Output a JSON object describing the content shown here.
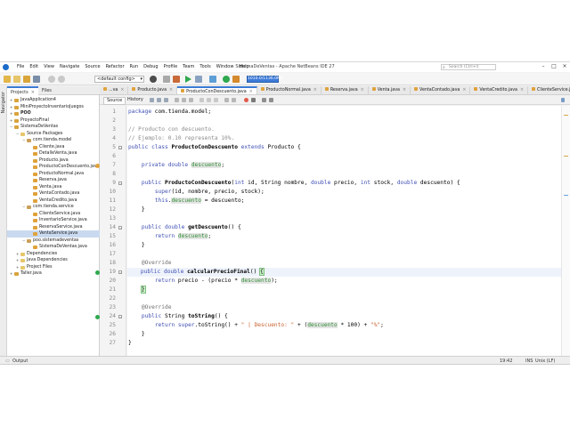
{
  "window": {
    "title": "SistemaDeVentas - Apache NetBeans IDE 27",
    "search_placeholder": "Search (Ctrl+I)"
  },
  "menu": [
    "File",
    "Edit",
    "View",
    "Navigate",
    "Source",
    "Refactor",
    "Run",
    "Debug",
    "Profile",
    "Team",
    "Tools",
    "Window",
    "Help"
  ],
  "toolbar": {
    "config": "<default config>",
    "memory": "1010.0/1136.0MB"
  },
  "left_panel": {
    "side_label": "Navigator",
    "tabs": [
      {
        "label": "Projects",
        "close": "×"
      },
      {
        "label": "Files",
        "close": ""
      }
    ],
    "tree": [
      {
        "label": "JavaApplication4",
        "depth": 0,
        "toggle": "+",
        "icon": "project",
        "bold": false
      },
      {
        "label": "MiniProyectoInventarioJuegos",
        "depth": 0,
        "toggle": "+",
        "icon": "project",
        "bold": false
      },
      {
        "label": "POO",
        "depth": 0,
        "toggle": "+",
        "icon": "project",
        "bold": true
      },
      {
        "label": "ProyectoFinal",
        "depth": 0,
        "toggle": "+",
        "icon": "project",
        "bold": false
      },
      {
        "label": "SistemaDeVentas",
        "depth": 0,
        "toggle": "−",
        "icon": "project",
        "bold": false
      },
      {
        "label": "Source Packages",
        "depth": 1,
        "toggle": "−",
        "icon": "folder",
        "bold": false
      },
      {
        "label": "com.tienda.model",
        "depth": 2,
        "toggle": "−",
        "icon": "package",
        "bold": false
      },
      {
        "label": "Cliente.java",
        "depth": 3,
        "toggle": "",
        "icon": "java",
        "bold": false
      },
      {
        "label": "DetalleVenta.java",
        "depth": 3,
        "toggle": "",
        "icon": "java",
        "bold": false
      },
      {
        "label": "Producto.java",
        "depth": 3,
        "toggle": "",
        "icon": "java",
        "bold": false
      },
      {
        "label": "ProductoConDescuento.java",
        "depth": 3,
        "toggle": "",
        "icon": "java",
        "bold": false
      },
      {
        "label": "ProductoNormal.java",
        "depth": 3,
        "toggle": "",
        "icon": "java",
        "bold": false
      },
      {
        "label": "Reserva.java",
        "depth": 3,
        "toggle": "",
        "icon": "java",
        "bold": false
      },
      {
        "label": "Venta.java",
        "depth": 3,
        "toggle": "",
        "icon": "java",
        "bold": false
      },
      {
        "label": "VentaContado.java",
        "depth": 3,
        "toggle": "",
        "icon": "java",
        "bold": false
      },
      {
        "label": "VentaCredito.java",
        "depth": 3,
        "toggle": "",
        "icon": "java",
        "bold": false
      },
      {
        "label": "com.tienda.service",
        "depth": 2,
        "toggle": "−",
        "icon": "package",
        "bold": false
      },
      {
        "label": "ClienteService.java",
        "depth": 3,
        "toggle": "",
        "icon": "java",
        "bold": false
      },
      {
        "label": "InventarioService.java",
        "depth": 3,
        "toggle": "",
        "icon": "java",
        "bold": false
      },
      {
        "label": "ReservaService.java",
        "depth": 3,
        "toggle": "",
        "icon": "java",
        "bold": false
      },
      {
        "label": "VentaService.java",
        "depth": 3,
        "toggle": "",
        "icon": "java",
        "bold": false,
        "selected": true
      },
      {
        "label": "poo.sistemadeventas",
        "depth": 2,
        "toggle": "−",
        "icon": "package",
        "bold": false
      },
      {
        "label": "SistemaDeVentas.java",
        "depth": 3,
        "toggle": "",
        "icon": "java",
        "bold": false
      },
      {
        "label": "Dependencies",
        "depth": 1,
        "toggle": "+",
        "icon": "folder",
        "bold": false
      },
      {
        "label": "Java Dependencies",
        "depth": 1,
        "toggle": "+",
        "icon": "folder",
        "bold": false
      },
      {
        "label": "Project Files",
        "depth": 1,
        "toggle": "+",
        "icon": "folder",
        "bold": false
      },
      {
        "label": "Taller.java",
        "depth": 0,
        "toggle": "+",
        "icon": "project",
        "bold": false
      }
    ]
  },
  "editor": {
    "tabs": [
      {
        "label": "...va",
        "active": false
      },
      {
        "label": "Producto.java",
        "active": false
      },
      {
        "label": "ProductoConDescuento.java",
        "active": true
      },
      {
        "label": "ProductoNormal.java",
        "active": false
      },
      {
        "label": "Reserva.java",
        "active": false
      },
      {
        "label": "Venta.java",
        "active": false
      },
      {
        "label": "VentaContado.java",
        "active": false
      },
      {
        "label": "VentaCredito.java",
        "active": false
      },
      {
        "label": "ClienteService.java",
        "active": false
      }
    ],
    "tab_close": "×",
    "subtabs": [
      "Source",
      "History"
    ],
    "lines": [
      {
        "n": "1",
        "tokens": [
          [
            "kw",
            "package"
          ],
          [
            "nm",
            " com.tienda.model;"
          ]
        ]
      },
      {
        "n": "2",
        "tokens": []
      },
      {
        "n": "3",
        "tokens": [
          [
            "cm",
            "// Producto con descuento."
          ]
        ]
      },
      {
        "n": "4",
        "tokens": [
          [
            "cm",
            "// Ejemplo: 0.10 representa 10%."
          ]
        ]
      },
      {
        "n": "5",
        "tokens": [
          [
            "kw",
            "public class "
          ],
          [
            "dec",
            "ProductoConDescuento"
          ],
          [
            "kw",
            " extends "
          ],
          [
            "nm",
            "Producto {"
          ]
        ]
      },
      {
        "n": "6",
        "tokens": []
      },
      {
        "n": "7",
        "tokens": [
          [
            "nm",
            "    "
          ],
          [
            "kw",
            "private double "
          ],
          [
            "fdh",
            "descuento"
          ],
          [
            "nm",
            ";"
          ]
        ]
      },
      {
        "n": "8",
        "tokens": []
      },
      {
        "n": "9",
        "tokens": [
          [
            "nm",
            "    "
          ],
          [
            "kw",
            "public "
          ],
          [
            "dec",
            "ProductoConDescuento"
          ],
          [
            "nm",
            "("
          ],
          [
            "kw",
            "int"
          ],
          [
            "nm",
            " id, String nombre, "
          ],
          [
            "kw",
            "double"
          ],
          [
            "nm",
            " precio, "
          ],
          [
            "kw",
            "int"
          ],
          [
            "nm",
            " stock, "
          ],
          [
            "kw",
            "double"
          ],
          [
            "nm",
            " descuento) {"
          ]
        ]
      },
      {
        "n": "10",
        "tokens": [
          [
            "nm",
            "        "
          ],
          [
            "kw",
            "super"
          ],
          [
            "nm",
            "(id, nombre, precio, stock);"
          ]
        ]
      },
      {
        "n": "11",
        "tokens": [
          [
            "nm",
            "        "
          ],
          [
            "kw",
            "this"
          ],
          [
            "nm",
            "."
          ],
          [
            "fdh",
            "descuento"
          ],
          [
            "nm",
            " = descuento;"
          ]
        ]
      },
      {
        "n": "12",
        "tokens": [
          [
            "nm",
            "    }"
          ]
        ]
      },
      {
        "n": "13",
        "tokens": []
      },
      {
        "n": "14",
        "tokens": [
          [
            "nm",
            "    "
          ],
          [
            "kw",
            "public double "
          ],
          [
            "dec",
            "getDescuento"
          ],
          [
            "nm",
            "() {"
          ]
        ]
      },
      {
        "n": "15",
        "tokens": [
          [
            "nm",
            "        "
          ],
          [
            "kw",
            "return "
          ],
          [
            "fdh",
            "descuento"
          ],
          [
            "nm",
            ";"
          ]
        ]
      },
      {
        "n": "16",
        "tokens": [
          [
            "nm",
            "    }"
          ]
        ]
      },
      {
        "n": "17",
        "tokens": []
      },
      {
        "n": "18",
        "tokens": [
          [
            "nm",
            "    "
          ],
          [
            "an",
            "@Override"
          ]
        ]
      },
      {
        "n": "19",
        "tokens": [
          [
            "nm",
            "    "
          ],
          [
            "kw",
            "public double "
          ],
          [
            "dec",
            "calcularPrecioFinal"
          ],
          [
            "nm",
            "() "
          ],
          [
            "brk",
            "{"
          ]
        ],
        "current": true
      },
      {
        "n": "20",
        "tokens": [
          [
            "nm",
            "        "
          ],
          [
            "kw",
            "return "
          ],
          [
            "nm",
            "precio - (precio * "
          ],
          [
            "fdh",
            "descuento"
          ],
          [
            "nm",
            ");"
          ]
        ]
      },
      {
        "n": "21",
        "tokens": [
          [
            "nm",
            "    "
          ],
          [
            "brk",
            "}"
          ]
        ]
      },
      {
        "n": "22",
        "tokens": []
      },
      {
        "n": "23",
        "tokens": [
          [
            "nm",
            "    "
          ],
          [
            "an",
            "@Override"
          ]
        ]
      },
      {
        "n": "24",
        "tokens": [
          [
            "nm",
            "    "
          ],
          [
            "kw",
            "public "
          ],
          [
            "nm",
            "String "
          ],
          [
            "dec",
            "toString"
          ],
          [
            "nm",
            "() {"
          ]
        ]
      },
      {
        "n": "25",
        "tokens": [
          [
            "nm",
            "        "
          ],
          [
            "kw",
            "return super"
          ],
          [
            "nm",
            ".toString() + "
          ],
          [
            "st",
            "\" | Descuento: \""
          ],
          [
            "nm",
            " + ("
          ],
          [
            "fdh",
            "descuento"
          ],
          [
            "nm",
            " * 100) + "
          ],
          [
            "st",
            "\"%\""
          ],
          [
            "nm",
            ";"
          ]
        ]
      },
      {
        "n": "26",
        "tokens": [
          [
            "nm",
            "    }"
          ]
        ]
      },
      {
        "n": "27",
        "tokens": [
          [
            "nm",
            "}"
          ]
        ]
      }
    ]
  },
  "status": {
    "output_label": "Output",
    "position": "19:42",
    "mode": "INS",
    "line_ending": "Unix (LF)"
  },
  "colors": {
    "accent": "#3a7bd5",
    "keyword": "#3f4fb3",
    "field": "#2f8f34",
    "string": "#c9602c",
    "comment": "#8a8a8a"
  }
}
